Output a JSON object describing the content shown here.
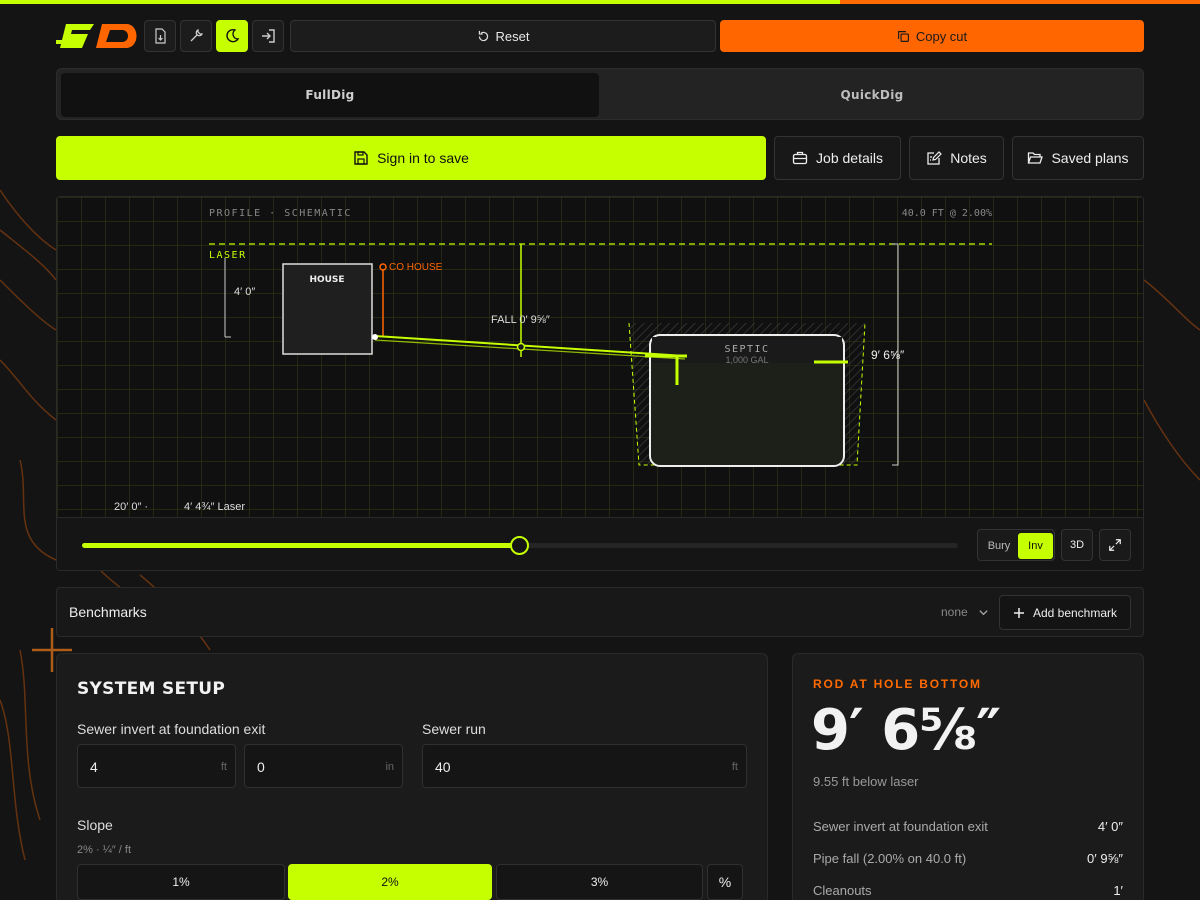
{
  "top_progress": {
    "fraction": 0.7
  },
  "header": {
    "logo_text": "SD",
    "buttons": [
      {
        "icon": "file-export-icon"
      },
      {
        "icon": "wrench-icon"
      },
      {
        "icon": "moon-icon"
      },
      {
        "icon": "login-icon"
      }
    ],
    "reset_label": "Reset",
    "copy_label": "Copy cut"
  },
  "mode_tabs": {
    "active": "FullDig",
    "inactive": "QuickDig"
  },
  "actions": {
    "sign_in": "Sign in to save",
    "job_details": "Job details",
    "notes": "Notes",
    "saved_plans": "Saved plans"
  },
  "profile": {
    "title": "PROFILE · SCHEMATIC",
    "run_info": "40.0 FT @ 2.00%",
    "laser_label": "LASER",
    "house_label": "HOUSE",
    "co_label": "CO HOUSE",
    "invert_dim": "4′ 0″",
    "fall_label": "FALL 0′ 9⅝″",
    "septic_label": "SEPTIC",
    "septic_size": "1,000 GAL",
    "depth_label": "9′ 6⅝″",
    "footer_distance": "20′ 0″ ·",
    "footer_laser": "4′ 4¾″ Laser",
    "slider_fraction": 0.5,
    "view_modes": [
      "Bury",
      "Inv"
    ],
    "active_view": "Inv",
    "btn_3d": "3D"
  },
  "benchmarks": {
    "title": "Benchmarks",
    "selected": "none",
    "add_label": "Add benchmark"
  },
  "system_setup": {
    "title": "SYSTEM SETUP",
    "invert_label": "Sewer invert at foundation exit",
    "invert_ft": "4",
    "invert_ft_unit": "ft",
    "invert_in": "0",
    "invert_in_unit": "in",
    "run_label": "Sewer run",
    "run_value": "40",
    "run_unit": "ft",
    "slope_label": "Slope",
    "slope_sub": "2% · ¼″ / ft",
    "slope_options": [
      "1%",
      "2%",
      "3%"
    ],
    "slope_selected": "2%",
    "slope_custom": "%"
  },
  "result": {
    "label": "ROD AT HOLE BOTTOM",
    "value": "9′ 6⅝″",
    "sub": "9.55 ft below laser",
    "rows": [
      {
        "label": "Sewer invert at foundation exit",
        "value": "4′ 0″"
      },
      {
        "label": "Pipe fall (2.00% on 40.0 ft)",
        "value": "0′ 9⅝″"
      },
      {
        "label": "Cleanouts",
        "value": "1′"
      }
    ]
  },
  "colors": {
    "accent": "#c6ff00",
    "orange": "#ff6600",
    "background": "#141414"
  }
}
